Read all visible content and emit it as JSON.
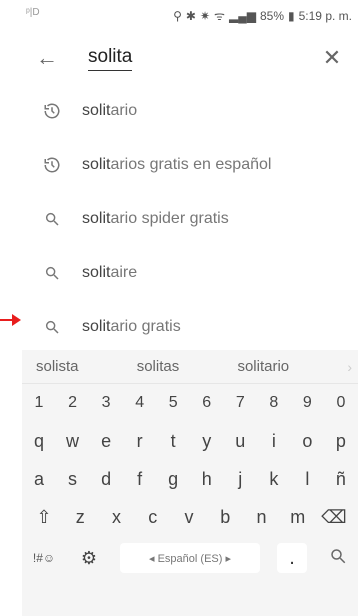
{
  "status_bar": {
    "left_text": "ᵖ|D",
    "battery": "85%",
    "time": "5:19 p. m."
  },
  "search": {
    "query": "solita"
  },
  "suggestions": [
    {
      "prefix": "solit",
      "rest": "ario",
      "icon": "history-icon"
    },
    {
      "prefix": "solit",
      "rest": "arios gratis en español",
      "icon": "history-icon"
    },
    {
      "prefix": "solit",
      "rest": "ario spider gratis",
      "icon": "search-icon"
    },
    {
      "prefix": "solit",
      "rest": "aire",
      "icon": "search-icon"
    },
    {
      "prefix": "solit",
      "rest": "ario gratis",
      "icon": "search-icon"
    }
  ],
  "keyboard": {
    "predictions": [
      "solista",
      "solitas",
      "solitario"
    ],
    "row_numbers": [
      "1",
      "2",
      "3",
      "4",
      "5",
      "6",
      "7",
      "8",
      "9",
      "0"
    ],
    "row1": [
      "q",
      "w",
      "e",
      "r",
      "t",
      "y",
      "u",
      "i",
      "o",
      "p"
    ],
    "row2": [
      "a",
      "s",
      "d",
      "f",
      "g",
      "h",
      "j",
      "k",
      "l",
      "ñ"
    ],
    "row3": [
      "z",
      "x",
      "c",
      "v",
      "b",
      "n",
      "m"
    ],
    "symbols_label": "!#☺",
    "space_label": "◂ Español (ES) ▸",
    "period": "."
  },
  "colors": {
    "arrow": "#e81e1e",
    "keyboard_bg": "#f5f5f5"
  }
}
